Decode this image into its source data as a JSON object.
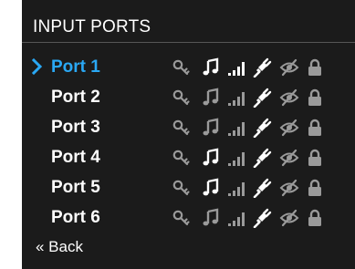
{
  "panel": {
    "title": "INPUT PORTS"
  },
  "ports": [
    {
      "label": "Port 1",
      "selected": true,
      "icons_highlighted": [
        "music-note-icon",
        "signal-icon",
        "plug-icon"
      ]
    },
    {
      "label": "Port 2",
      "selected": false,
      "icons_highlighted": [
        "plug-icon"
      ]
    },
    {
      "label": "Port 3",
      "selected": false,
      "icons_highlighted": [
        "plug-icon"
      ]
    },
    {
      "label": "Port 4",
      "selected": false,
      "icons_highlighted": [
        "music-note-icon",
        "plug-icon"
      ]
    },
    {
      "label": "Port 5",
      "selected": false,
      "icons_highlighted": [
        "music-note-icon",
        "plug-icon"
      ]
    },
    {
      "label": "Port 6",
      "selected": false,
      "icons_highlighted": [
        "plug-icon"
      ]
    }
  ],
  "row_icons": [
    "key-icon",
    "music-note-icon",
    "signal-icon",
    "plug-icon",
    "hidden-icon",
    "lock-icon"
  ],
  "back": {
    "label": "« Back"
  },
  "colors": {
    "accent": "#2aa8f4",
    "background": "#1b1b1b",
    "icon_active": "#ffffff",
    "icon_inactive": "#9a9a9a"
  }
}
